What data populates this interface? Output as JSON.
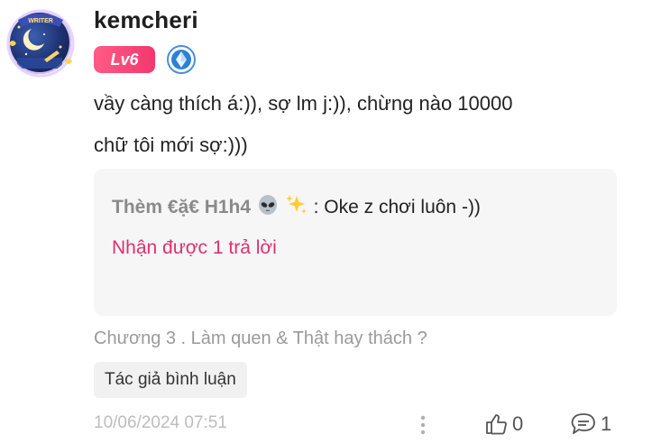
{
  "user": {
    "name": "kemcheri",
    "level": "Lv6",
    "avatar_text": "WRITER",
    "badge_color": "#f2386e"
  },
  "comment": {
    "text_line1": "vầy càng thích á:)), sợ lm j:)), chừng nào 10000",
    "text_line2": "chữ tôi mới sợ:)))"
  },
  "reply_preview": {
    "author": "Thèm €ặ€ H1h4",
    "text": ": Oke z chơi luôn -))",
    "reply_count_label": "Nhận được 1 trả lời",
    "accent_color": "#e0306f"
  },
  "chapter": "Chương 3 . Làm quen & Thật hay thách ?",
  "author_tag": "Tác giả bình luận",
  "footer": {
    "timestamp": "10/06/2024 07:51",
    "like_count": "0",
    "reply_count": "1"
  },
  "icons": [
    "avatar",
    "rank-diamond-icon",
    "alien-emoji-icon",
    "sparkles-emoji-icon",
    "more-vertical-icon",
    "thumbs-up-icon",
    "comment-icon"
  ]
}
